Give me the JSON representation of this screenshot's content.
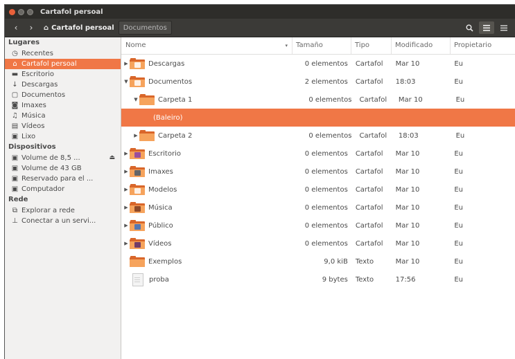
{
  "window": {
    "title": "Cartafol persoal"
  },
  "toolbar": {
    "crumbs": [
      {
        "label": "Cartafol persoal"
      },
      {
        "label": "Documentos"
      }
    ],
    "search_icon": "search-icon",
    "list_view_icon": "list-view-icon",
    "menu_icon": "hamburger-menu-icon"
  },
  "sidebar": {
    "sections": [
      {
        "title": "Lugares",
        "items": [
          {
            "label": "Recentes",
            "icon": "clock-icon"
          },
          {
            "label": "Cartafol persoal",
            "icon": "home-icon",
            "selected": true
          },
          {
            "label": "Escritorio",
            "icon": "desktop-icon"
          },
          {
            "label": "Descargas",
            "icon": "download-icon"
          },
          {
            "label": "Documentos",
            "icon": "document-icon"
          },
          {
            "label": "Imaxes",
            "icon": "camera-icon"
          },
          {
            "label": "Música",
            "icon": "music-icon"
          },
          {
            "label": "Vídeos",
            "icon": "film-icon"
          },
          {
            "label": "Lixo",
            "icon": "trash-icon"
          }
        ]
      },
      {
        "title": "Dispositivos",
        "items": [
          {
            "label": "Volume de 8,5 ...",
            "icon": "drive-icon",
            "eject": true
          },
          {
            "label": "Volume de 43 GB",
            "icon": "drive-icon"
          },
          {
            "label": "Reservado para el ...",
            "icon": "drive-icon"
          },
          {
            "label": "Computador",
            "icon": "drive-icon"
          }
        ]
      },
      {
        "title": "Rede",
        "items": [
          {
            "label": "Explorar a rede",
            "icon": "network-icon"
          },
          {
            "label": "Conectar a un servi...",
            "icon": "server-icon"
          }
        ]
      }
    ]
  },
  "columns": {
    "name": "Nome",
    "size": "Tamaño",
    "type": "Tipo",
    "modified": "Modificado",
    "owner": "Propietario",
    "sort_indicator": "▾"
  },
  "colors": {
    "accent": "#f07746",
    "folder_back": "#d9662a",
    "folder_front": "#f6a35c"
  },
  "rows": [
    {
      "name": "Descargas",
      "size": "0 elementos",
      "type": "Cartafol",
      "modified": "Mar 10",
      "owner": "Eu",
      "expander": "▶",
      "indent": 0,
      "kind": "folder",
      "emblem": "download"
    },
    {
      "name": "Documentos",
      "size": "2 elementos",
      "type": "Cartafol",
      "modified": "18:03",
      "owner": "Eu",
      "expander": "▼",
      "indent": 0,
      "kind": "folder",
      "emblem": "document"
    },
    {
      "name": "Carpeta 1",
      "size": "0 elementos",
      "type": "Cartafol",
      "modified": "Mar 10",
      "owner": "Eu",
      "expander": "▼",
      "indent": 1,
      "kind": "folder"
    },
    {
      "name": "(Baleiro)",
      "size": "",
      "type": "",
      "modified": "",
      "owner": "",
      "expander": "",
      "indent": 2,
      "kind": "empty",
      "selected": true
    },
    {
      "name": "Carpeta 2",
      "size": "0 elementos",
      "type": "Cartafol",
      "modified": "18:03",
      "owner": "Eu",
      "expander": "▶",
      "indent": 1,
      "kind": "folder"
    },
    {
      "name": "Escritorio",
      "size": "0 elementos",
      "type": "Cartafol",
      "modified": "Mar 10",
      "owner": "Eu",
      "expander": "▶",
      "indent": 0,
      "kind": "folder",
      "emblem": "desktop"
    },
    {
      "name": "Imaxes",
      "size": "0 elementos",
      "type": "Cartafol",
      "modified": "Mar 10",
      "owner": "Eu",
      "expander": "▶",
      "indent": 0,
      "kind": "folder",
      "emblem": "pictures"
    },
    {
      "name": "Modelos",
      "size": "0 elementos",
      "type": "Cartafol",
      "modified": "Mar 10",
      "owner": "Eu",
      "expander": "▶",
      "indent": 0,
      "kind": "folder",
      "emblem": "templates"
    },
    {
      "name": "Música",
      "size": "0 elementos",
      "type": "Cartafol",
      "modified": "Mar 10",
      "owner": "Eu",
      "expander": "▶",
      "indent": 0,
      "kind": "folder",
      "emblem": "music"
    },
    {
      "name": "Público",
      "size": "0 elementos",
      "type": "Cartafol",
      "modified": "Mar 10",
      "owner": "Eu",
      "expander": "▶",
      "indent": 0,
      "kind": "folder",
      "emblem": "public"
    },
    {
      "name": "Vídeos",
      "size": "0 elementos",
      "type": "Cartafol",
      "modified": "Mar 10",
      "owner": "Eu",
      "expander": "▶",
      "indent": 0,
      "kind": "folder",
      "emblem": "videos"
    },
    {
      "name": "Exemplos",
      "size": "9,0 kiB",
      "type": "Texto",
      "modified": "Mar 10",
      "owner": "Eu",
      "expander": "",
      "indent": 0,
      "kind": "folder"
    },
    {
      "name": "proba",
      "size": "9 bytes",
      "type": "Texto",
      "modified": "17:56",
      "owner": "Eu",
      "expander": "",
      "indent": 0,
      "kind": "file"
    }
  ]
}
